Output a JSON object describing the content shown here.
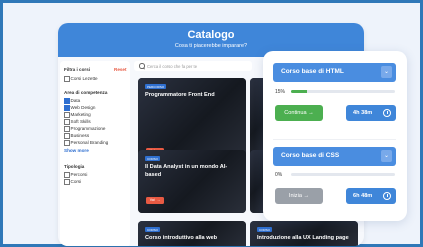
{
  "header": {
    "title": "Catalogo",
    "subtitle": "Cosa ti piacerebbe imparare?"
  },
  "filters": {
    "title": "Filtra i corsi",
    "reset_label": "Reset",
    "lezione_label": "Corsi Lezette",
    "area_title": "Area di competenza",
    "areas": [
      {
        "label": "Data",
        "checked": true
      },
      {
        "label": "Web Design",
        "checked": true
      },
      {
        "label": "Marketing",
        "checked": false
      },
      {
        "label": "Soft Skills",
        "checked": false
      },
      {
        "label": "Programmazione",
        "checked": false
      },
      {
        "label": "Business",
        "checked": false
      },
      {
        "label": "Personal Branding",
        "checked": false
      }
    ],
    "show_more": "Show more",
    "type_title": "Tipologia",
    "types": [
      {
        "label": "Percorsi"
      },
      {
        "label": "Corsi"
      }
    ]
  },
  "search": {
    "placeholder": "Cerca il corso che fa per te"
  },
  "cards": [
    {
      "tag": "PERCORSO",
      "title_l1": "Programmatore Front End",
      "title_l2": "",
      "button": "Vai"
    },
    {
      "tag": "CORSO",
      "title_l1": "Il Data Analyst in un mondo AI-",
      "title_l2": "based",
      "button": "Vai"
    },
    {
      "tag": "CORSO",
      "title_l1": "Corso introduttivo alla web",
      "title_l2": "",
      "button": ""
    },
    {
      "tag": "CORSO",
      "title_l1": "Introduzione alla UX Landing page",
      "title_l2": "",
      "button": ""
    }
  ],
  "panel": {
    "courses": [
      {
        "title": "Corso base di HTML",
        "progress_label": "15%",
        "progress": 0.15,
        "action": "Continua →",
        "time": "4h 38m"
      },
      {
        "title": "Corso base di CSS",
        "progress_label": "0%",
        "progress": 0.0,
        "action": "Inizia →",
        "time": "6h 48m"
      }
    ]
  },
  "colors": {
    "primary": "#3f86d9",
    "accent": "#e85a43",
    "success": "#4caf50",
    "frame": "#2f78b8"
  }
}
